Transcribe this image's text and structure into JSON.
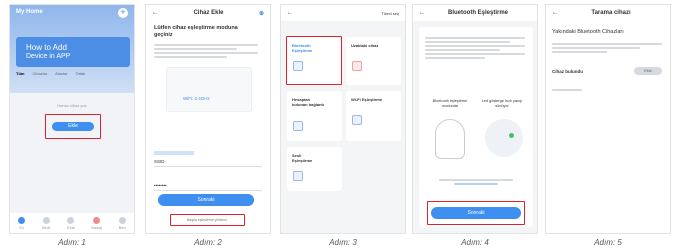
{
  "captions": [
    "Adım: 1",
    "Adım: 2",
    "Adım: 3",
    "Adım: 4",
    "Adım: 5"
  ],
  "step1": {
    "home_title": "My Home",
    "banner_line1": "How to Add",
    "banner_line2": "Device in APP",
    "tabs": [
      "Tüm",
      "Cihazlar",
      "Alanlar",
      "Ortak"
    ],
    "empty_text": "Henüz cihaz yok",
    "add_button": "Ekle",
    "nav": [
      "Ev",
      "Akıllı",
      "Ekle",
      "Mesaj",
      "Ben"
    ]
  },
  "step2": {
    "back": "←",
    "title": "Cihaz Ekle",
    "heading": "Lütfen cihaz eşleştirme moduna geçiniz",
    "wifi_label": "WiFi: 2.4GHz",
    "network_value": "SSID",
    "password_value": "••••••••",
    "primary_button": "Sonraki",
    "link": "Başka eşleştirme yöntemi"
  },
  "step3": {
    "back": "←",
    "top_right": "Tümü seç",
    "options": [
      "Bluetooth Eşleştirme",
      "Uzaktaki cihaz",
      "Hesaptan bulunan bağlantı",
      "Wi-Fi Eşleştirme",
      "Sesli Eşleştirme"
    ]
  },
  "step4": {
    "back": "←",
    "title": "Bluetooth Eşleştirme",
    "left_caption": "Bluetooth eşleştirme modunda",
    "right_caption": "Led gösterge hızlı yanıp sönüyor",
    "button": "Sonraki"
  },
  "step5": {
    "back": "←",
    "title": "Tarama cihazı",
    "heading": "Yakındaki Bluetooth Cihazları",
    "row_label": "Cihaz bulundu",
    "row_button": "Ekle"
  },
  "colors": {
    "accent": "#3e8ff0",
    "highlight": "#e0212e"
  }
}
